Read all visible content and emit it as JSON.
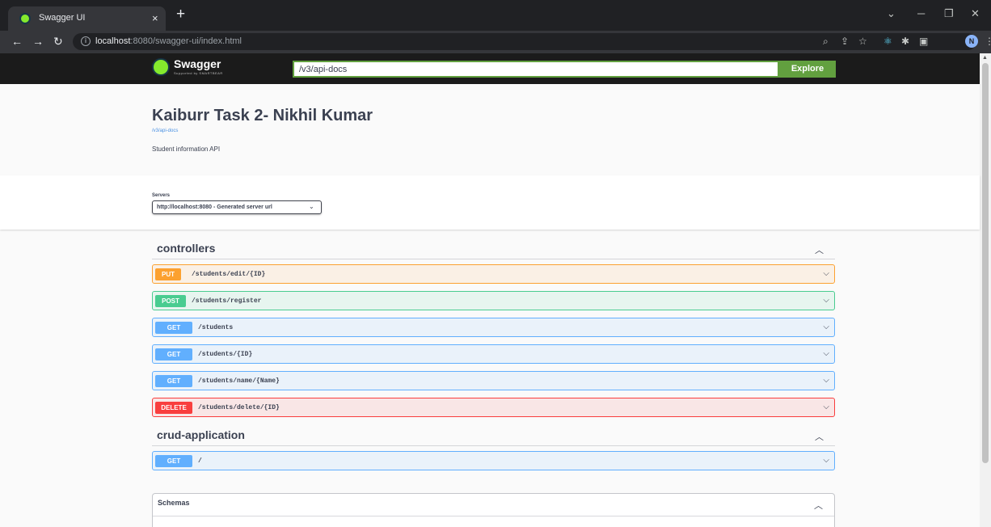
{
  "browser": {
    "tab_title": "Swagger UI",
    "tab_close": "×",
    "new_tab": "+",
    "url_host": "localhost",
    "url_path": ":8080/swagger-ui/index.html",
    "profile_initial": "N",
    "window_controls": {
      "dropdown": "⌄",
      "minimize": "─",
      "restore": "❐",
      "close": "✕"
    }
  },
  "swagger": {
    "logo_text": "Swagger",
    "logo_subtext": "Supported by SMARTBEAR",
    "url_input_value": "/v3/api-docs",
    "explore_label": "Explore"
  },
  "info": {
    "title": "Kaiburr Task 2- Nikhil Kumar",
    "link": "/v3/api-docs",
    "description": "Student information API"
  },
  "servers": {
    "label": "Servers",
    "selected": "http://localhost:8080 - Generated server url"
  },
  "tags": [
    {
      "name": "controllers",
      "operations": [
        {
          "method": "PUT",
          "path": "/students/edit/{ID}",
          "kind": "put"
        },
        {
          "method": "POST",
          "path": "/students/register",
          "kind": "post"
        },
        {
          "method": "GET",
          "path": "/students",
          "kind": "get"
        },
        {
          "method": "GET",
          "path": "/students/{ID}",
          "kind": "get"
        },
        {
          "method": "GET",
          "path": "/students/name/{Name}",
          "kind": "get"
        },
        {
          "method": "DELETE",
          "path": "/students/delete/{ID}",
          "kind": "delete"
        }
      ]
    },
    {
      "name": "crud-application",
      "operations": [
        {
          "method": "GET",
          "path": "/",
          "kind": "get"
        }
      ]
    }
  ],
  "schemas": {
    "title": "Schemas"
  },
  "colors": {
    "put": "#fca130",
    "post": "#49cc90",
    "get": "#61affe",
    "delete": "#f93e3e",
    "explore": "#62a03f",
    "topbar": "#1b1b1b"
  }
}
